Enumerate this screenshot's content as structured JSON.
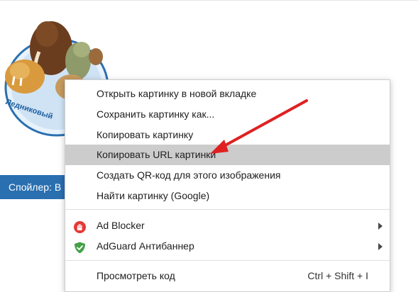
{
  "page": {
    "logo_text": "Ледниковый",
    "spoiler_label": "Спойлер: В"
  },
  "context_menu": {
    "items": [
      {
        "label": "Открыть картинку в новой вкладке"
      },
      {
        "label": "Сохранить картинку как..."
      },
      {
        "label": "Копировать картинку"
      },
      {
        "label": "Копировать URL картинки",
        "highlighted": true
      },
      {
        "label": "Создать QR-код для этого изображения"
      },
      {
        "label": "Найти картинку (Google)"
      }
    ],
    "extensions": [
      {
        "label": "Ad Blocker",
        "icon": "ad-blocker-hand-icon",
        "has_submenu": true
      },
      {
        "label": "AdGuard Антибаннер",
        "icon": "adguard-shield-icon",
        "has_submenu": true
      }
    ],
    "inspect": {
      "label": "Просмотреть код",
      "shortcut": "Ctrl + Shift + I"
    }
  },
  "colors": {
    "highlight": "#cccccc",
    "spoiler_bg": "#2a6fb0",
    "arrow": "#e02020",
    "ad_blocker_red": "#e53935",
    "adguard_green": "#43a047"
  }
}
